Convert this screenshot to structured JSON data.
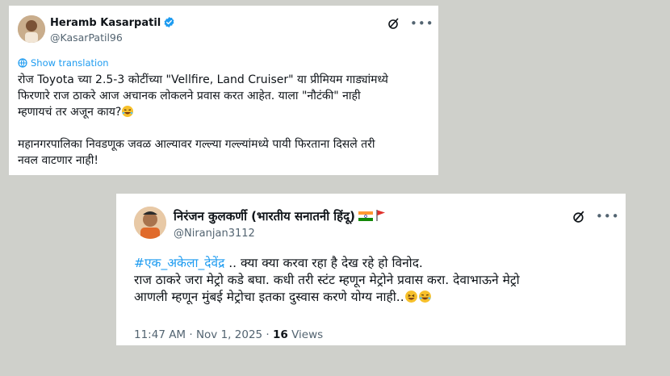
{
  "tweet1": {
    "author_name": "Heramb Kasarpatil",
    "handle": "@KasarPatil96",
    "show_translation": "Show translation",
    "lines": [
      "रोज Toyota च्या 2.5-3 कोटींच्या \"Vellfire, Land Cruiser\" या प्रीमियम गाड्यांमध्ये",
      "फिरणारे राज ठाकरे आज अचानक लोकलने प्रवास करत आहेत. याला \"नौटंकी\" नाही",
      "म्हणायचं तर अजून काय?"
    ],
    "lines2": [
      "महानगरपालिका निवडणूक जवळ आल्यावर गल्ल्या गल्ल्यांमध्ये पायी फिरताना दिसले तरी",
      "नवल वाटणार नाही!"
    ],
    "verified_color": "#1d9bf0"
  },
  "tweet2": {
    "author_name": "निरंजन कुलकर्णी (भारतीय सनातनी हिंदू)",
    "handle": "@Niranjan3112",
    "hashtag": "#एक_अकेला_देवेंद्र",
    "line1_rest": " .. क्या क्या करवा रहा है देख रहे हो विनोद.",
    "line2": "राज ठाकरे जरा मेट्रो कडे बघा. कधी तरी स्टंट म्हणून मेट्रोने प्रवास करा. देवाभाऊने मेट्रो",
    "line3": "आणली म्हणून मुंबई मेट्रोचा इतका दुस्वास करणे योग्य नाही..",
    "time": "11:47 AM · Nov 1, 2025 · ",
    "views_count": "16",
    "views_label": " Views"
  },
  "colors": {
    "link": "#1d9bf0",
    "secondary_text": "#536471",
    "background": "#cfd0cb"
  },
  "icons": {
    "grok": "grok-icon",
    "more": "more-icon",
    "translate": "globe-icon",
    "verified": "verified-badge-icon",
    "laughing": "rolling-laughing-emoji",
    "grinning": "grinning-squinting-emoji",
    "india_flag": "india-flag-icon",
    "red_flag": "red-flag-icon"
  }
}
